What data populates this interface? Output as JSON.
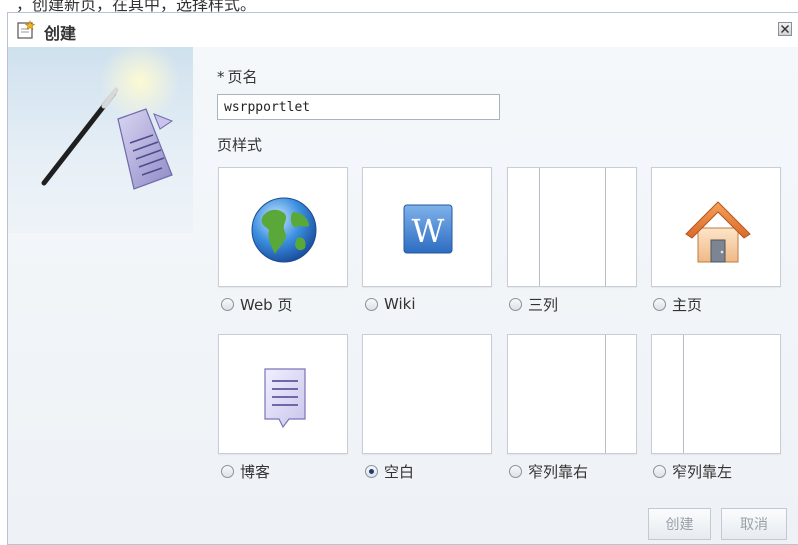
{
  "top_strip": {
    "text": "，创建新页，在其中，选择样式。"
  },
  "dialog": {
    "title": "创建",
    "close_icon": "close-icon"
  },
  "form": {
    "name_label": "页名",
    "required_mark": "*",
    "name_value": "wsrpportlet",
    "style_label": "页样式"
  },
  "styles": [
    {
      "label": "Web 页",
      "icon": "globe-icon",
      "checked": false
    },
    {
      "label": "Wiki",
      "icon": "wiki-w-icon",
      "checked": false
    },
    {
      "label": "三列",
      "icon": "three-column-layout-icon",
      "checked": false
    },
    {
      "label": "主页",
      "icon": "house-icon",
      "checked": false
    },
    {
      "label": "博客",
      "icon": "blog-note-icon",
      "checked": false
    },
    {
      "label": "空白",
      "icon": "blank-layout-icon",
      "checked": true
    },
    {
      "label": "窄列靠右",
      "icon": "narrow-right-layout-icon",
      "checked": false
    },
    {
      "label": "窄列靠左",
      "icon": "narrow-left-layout-icon",
      "checked": false
    }
  ],
  "buttons": {
    "create": "创建",
    "cancel": "取消"
  },
  "colors": {
    "dialog_bg": "#eef2f6",
    "border": "#b9c3cf",
    "disabled_text": "#9aa1a9",
    "radio_selected": "#1f3d73"
  }
}
